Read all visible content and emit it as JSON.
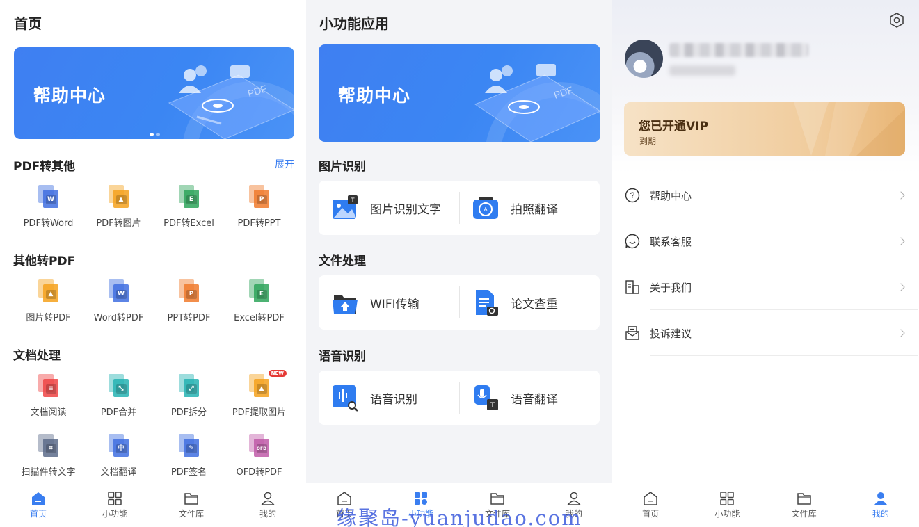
{
  "home": {
    "title": "首页",
    "banner": {
      "text": "帮助中心",
      "pdf_text": "PDF"
    },
    "pdf_to_other": {
      "title": "PDF转其他",
      "expand": "展开",
      "items": [
        {
          "label": "PDF转Word",
          "icon": "pdf-to-word-icon",
          "tag": "W",
          "color": "#3f6fe0"
        },
        {
          "label": "PDF转图片",
          "icon": "pdf-to-image-icon",
          "tag": "▲",
          "color": "#f4a11c"
        },
        {
          "label": "PDF转Excel",
          "icon": "pdf-to-excel-icon",
          "tag": "E",
          "color": "#2ea55a"
        },
        {
          "label": "PDF转PPT",
          "icon": "pdf-to-ppt-icon",
          "tag": "P",
          "color": "#f07a2b"
        }
      ]
    },
    "other_to_pdf": {
      "title": "其他转PDF",
      "items": [
        {
          "label": "图片转PDF",
          "icon": "image-to-pdf-icon",
          "tag": "▲",
          "color": "#f4a11c"
        },
        {
          "label": "Word转PDF",
          "icon": "word-to-pdf-icon",
          "tag": "W",
          "color": "#3f6fe0"
        },
        {
          "label": "PPT转PDF",
          "icon": "ppt-to-pdf-icon",
          "tag": "P",
          "color": "#f07a2b"
        },
        {
          "label": "Excel转PDF",
          "icon": "excel-to-pdf-icon",
          "tag": "E",
          "color": "#2ea55a"
        }
      ]
    },
    "doc_processing": {
      "title": "文档处理",
      "new_badge": "NEW",
      "row1": [
        {
          "label": "文档阅读",
          "icon": "doc-read-icon",
          "tag": "≡",
          "color": "#ef4444"
        },
        {
          "label": "PDF合并",
          "icon": "pdf-merge-icon",
          "tag": "⤡",
          "color": "#26b3b3"
        },
        {
          "label": "PDF拆分",
          "icon": "pdf-split-icon",
          "tag": "⤢",
          "color": "#26b3b3"
        },
        {
          "label": "PDF提取图片",
          "icon": "pdf-extract-image-icon",
          "tag": "▲",
          "color": "#f4a11c"
        }
      ],
      "row2": [
        {
          "label": "扫描件转文字",
          "icon": "scan-to-text-icon",
          "tag": "⌗",
          "color": "#5c6b8a"
        },
        {
          "label": "文档翻译",
          "icon": "doc-translate-icon",
          "tag": "中",
          "color": "#3f6fe0"
        },
        {
          "label": "PDF签名",
          "icon": "pdf-sign-icon",
          "tag": "✎",
          "color": "#3f6fe0"
        },
        {
          "label": "OFD转PDF",
          "icon": "ofd-to-pdf-icon",
          "tag": "OFD",
          "color": "#c05aa8"
        }
      ]
    }
  },
  "tools": {
    "title": "小功能应用",
    "banner": {
      "text": "帮助中心",
      "pdf_text": "PDF"
    },
    "sections": [
      {
        "title": "图片识别",
        "items": [
          {
            "label": "图片识别文字",
            "icon": "image-ocr-icon"
          },
          {
            "label": "拍照翻译",
            "icon": "photo-translate-icon"
          }
        ]
      },
      {
        "title": "文件处理",
        "items": [
          {
            "label": "WIFI传输",
            "icon": "wifi-transfer-icon"
          },
          {
            "label": "论文查重",
            "icon": "paper-check-icon"
          }
        ]
      },
      {
        "title": "语音识别",
        "items": [
          {
            "label": "语音识别",
            "icon": "voice-recognition-icon"
          },
          {
            "label": "语音翻译",
            "icon": "voice-translate-icon"
          }
        ]
      }
    ]
  },
  "mine": {
    "vip_title": "您已开通VIP",
    "vip_sub": "到期",
    "menu": [
      {
        "label": "帮助中心",
        "icon": "help-icon"
      },
      {
        "label": "联系客服",
        "icon": "customer-service-icon"
      },
      {
        "label": "关于我们",
        "icon": "about-icon"
      },
      {
        "label": "投诉建议",
        "icon": "feedback-icon"
      }
    ]
  },
  "tabs": [
    "首页",
    "小功能",
    "文件库",
    "我的"
  ],
  "watermark": "缘聚岛-yuanjudao.com",
  "colors": {
    "accent": "#3a7ef0",
    "banner": "#3f7ff2",
    "vip_gold": "#f0cb9b"
  }
}
